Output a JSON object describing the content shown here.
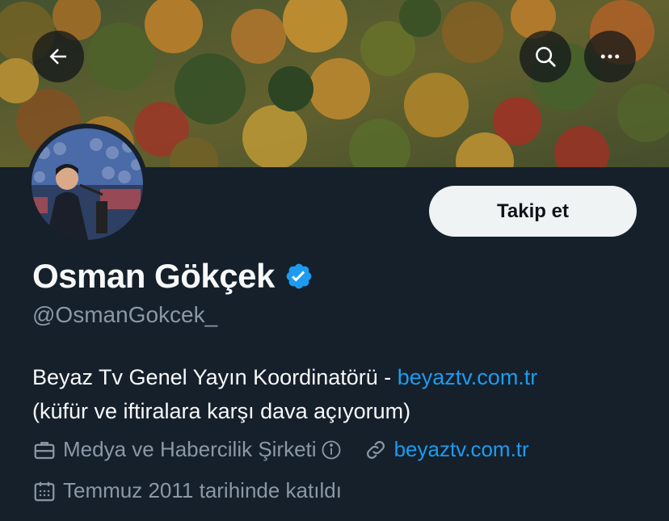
{
  "header": {
    "back_icon": "arrow-left-icon",
    "search_icon": "search-icon",
    "more_icon": "more-horizontal-icon"
  },
  "profile": {
    "display_name": "Osman Gökçek",
    "handle": "@OsmanGokcek_",
    "verified": true,
    "follow_label": "Takip et",
    "bio_text": "Beyaz Tv Genel Yayın Koordinatörü - ",
    "bio_link": "beyaztv.com.tr",
    "bio_line2": "(küfür ve iftiralara karşı dava açıyorum)",
    "category": "Medya ve Habercilik Şirketi",
    "website": "beyaztv.com.tr",
    "joined": "Temmuz 2011 tarihinde katıldı"
  },
  "colors": {
    "background": "#15202b",
    "accent": "#1d9bf0",
    "secondary_text": "#8b98a5",
    "follow_button_bg": "#eff3f4"
  }
}
